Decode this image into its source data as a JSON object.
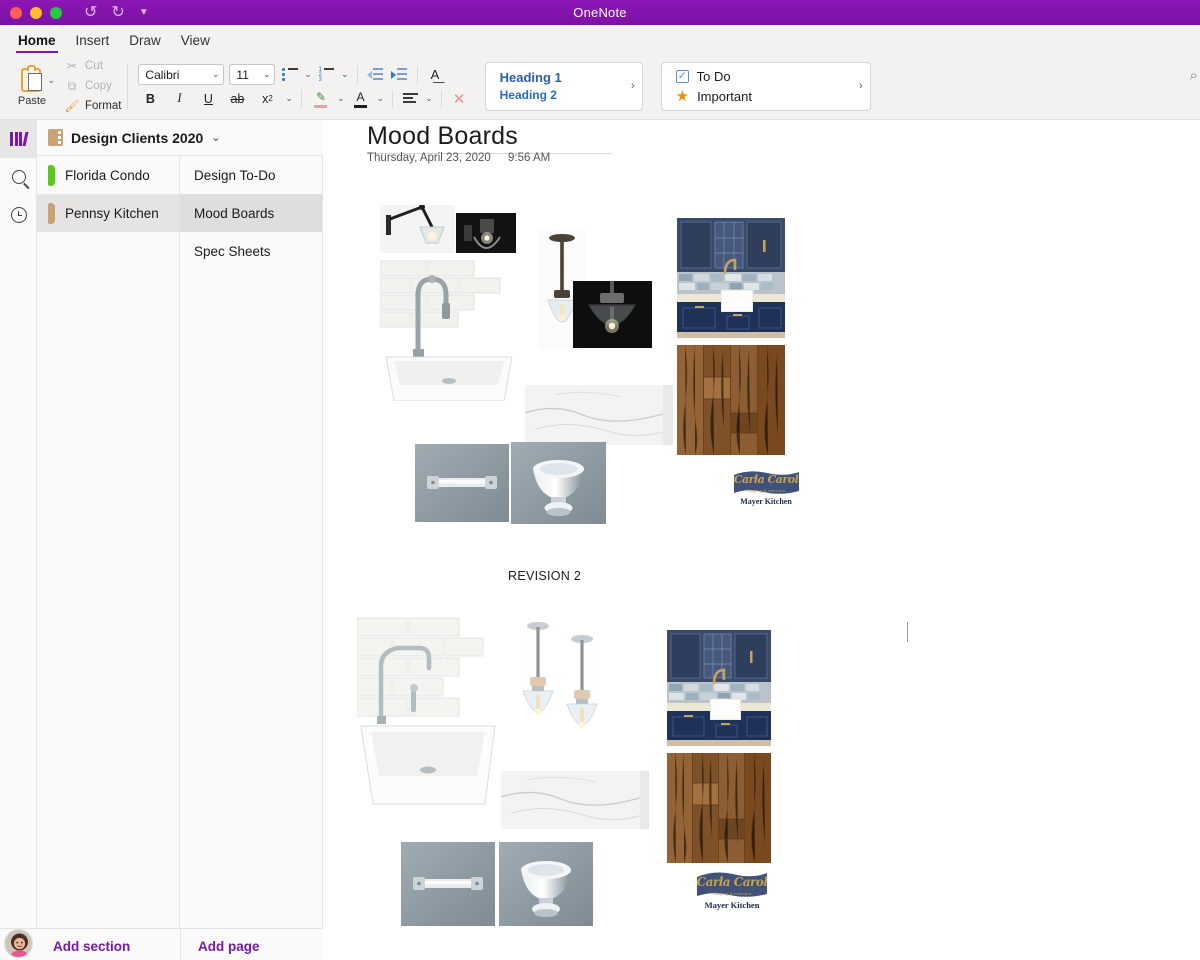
{
  "window": {
    "app_title": "OneNote"
  },
  "titlebar": {
    "undo_icon": "undo-arrow-icon",
    "redo_icon": "redo-arrow-icon",
    "more_icon": "customize-toolbar-icon"
  },
  "ribbon": {
    "tabs": [
      {
        "label": "Home",
        "active": true
      },
      {
        "label": "Insert",
        "active": false
      },
      {
        "label": "Draw",
        "active": false
      },
      {
        "label": "View",
        "active": false
      }
    ],
    "clipboard": {
      "paste_label": "Paste",
      "cut_label": "Cut",
      "copy_label": "Copy",
      "format_label": "Format"
    },
    "font": {
      "family": "Calibri",
      "size": "11",
      "bold": "B",
      "italic": "I",
      "underline": "U",
      "strikethrough": "ab",
      "subscript": "x",
      "subscript_index": "2"
    },
    "styles_gallery": {
      "heading1": "Heading 1",
      "heading2": "Heading 2",
      "expand_icon": "chevron-right-icon"
    },
    "tags_gallery": {
      "todo": "To Do",
      "important": "Important",
      "expand_icon": "chevron-right-icon"
    }
  },
  "rail": {
    "notebooks_icon": "notebooks-icon",
    "search_icon": "search-icon",
    "recent_icon": "recent-clock-icon"
  },
  "notebook": {
    "name": "Design Clients 2020",
    "chevron": "⌄"
  },
  "sections": [
    {
      "label": "Florida Condo",
      "color": "#5cc91a",
      "selected": false
    },
    {
      "label": "Pennsy Kitchen",
      "color": "#c9a376",
      "selected": true
    }
  ],
  "pages": [
    {
      "label": "Design To-Do",
      "selected": false
    },
    {
      "label": "Mood Boards",
      "selected": true
    },
    {
      "label": "Spec Sheets",
      "selected": false
    }
  ],
  "bottom": {
    "add_section": "Add section",
    "add_page": "Add page"
  },
  "page": {
    "title": "Mood Boards",
    "date": "Thursday, April 23, 2020",
    "time": "9:56 AM",
    "revision_label": "REVISION 2"
  },
  "logo": {
    "script": "Carla Carol",
    "tagline": "Staging & Interiors",
    "name": "Mayer Kitchen"
  },
  "colors": {
    "brand_purple": "#7719aa",
    "titlebar": "#8b16b5",
    "navy_cabinet": "#2c3f63",
    "wood_floor": "#8a5a30",
    "heading_blue": "#2b5ea8",
    "star_orange": "#f0900a"
  }
}
